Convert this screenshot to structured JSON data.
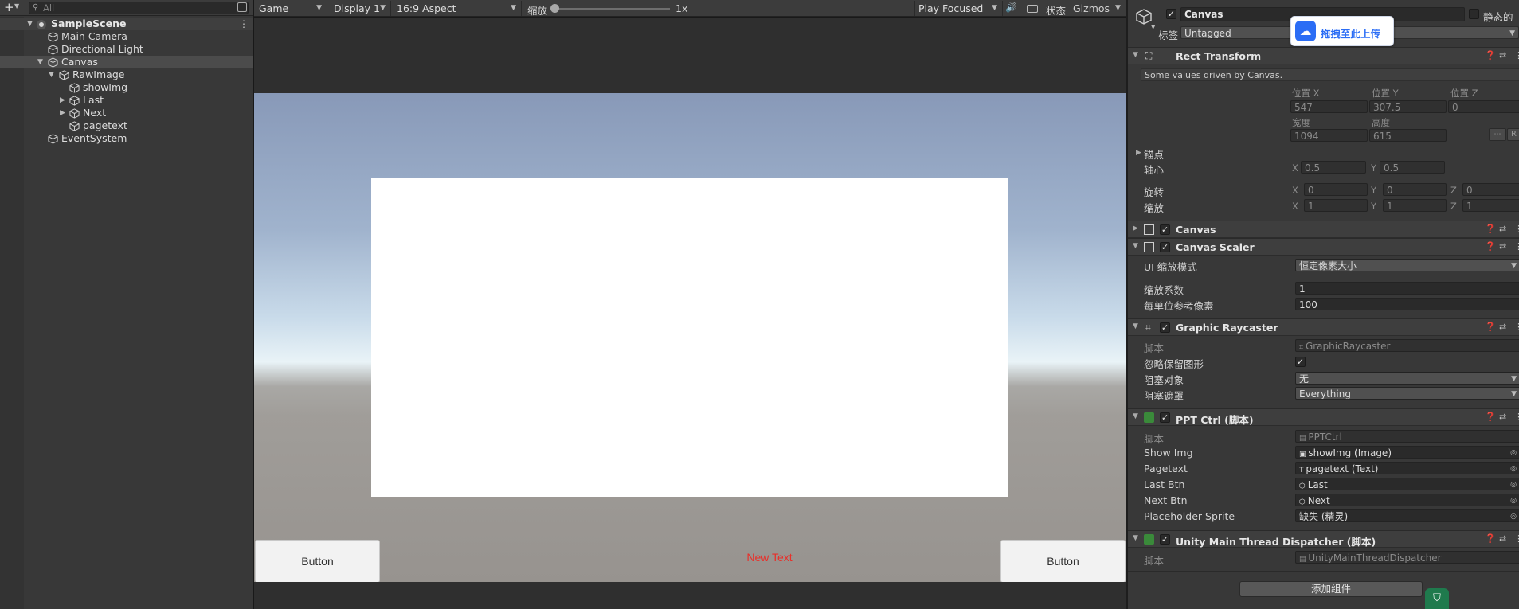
{
  "hierarchy": {
    "search_placeholder": "All",
    "scene": "SampleScene",
    "items": {
      "main_camera": "Main Camera",
      "directional_light": "Directional Light",
      "canvas": "Canvas",
      "rawimage": "RawImage",
      "showimg": "showImg",
      "last": "Last",
      "next": "Next",
      "pagetext": "pagetext",
      "eventsystem": "EventSystem"
    }
  },
  "gameview": {
    "view_select": "Game",
    "display_select": "Display 1",
    "aspect_select": "16:9 Aspect",
    "scale_label": "缩放",
    "scale_value": "1x",
    "play_mode": "Play Focused",
    "stats": "状态",
    "gizmos": "Gizmos",
    "button_left": "Button",
    "button_right": "Button",
    "center_text": "New Text"
  },
  "upload_badge": "拖拽至此上传",
  "inspector": {
    "object_name": "Canvas",
    "static_label": "静态的",
    "tag_label": "标签",
    "tag_value": "Untagged",
    "rect": {
      "title": "Rect Transform",
      "note": "Some values driven by Canvas.",
      "pos_x_label": "位置 X",
      "pos_y_label": "位置 Y",
      "pos_z_label": "位置 Z",
      "pos_x": "547",
      "pos_y": "307.5",
      "pos_z": "0",
      "width_label": "宽度",
      "height_label": "高度",
      "width": "1094",
      "height": "615",
      "r_btn": "R",
      "anchor_label": "锚点",
      "pivot_label": "轴心",
      "pivot_x": "0.5",
      "pivot_y": "0.5",
      "rotation_label": "旋转",
      "rot_x": "0",
      "rot_y": "0",
      "rot_z": "0",
      "scale_label": "缩放",
      "scale_x": "1",
      "scale_y": "1",
      "scale_z": "1",
      "x": "X",
      "y": "Y",
      "z": "Z"
    },
    "canvas_comp": {
      "title": "Canvas"
    },
    "scaler": {
      "title": "Canvas Scaler",
      "mode_label": "UI 缩放模式",
      "mode_value": "恒定像素大小",
      "factor_label": "缩放系数",
      "factor_value": "1",
      "ppu_label": "每单位参考像素",
      "ppu_value": "100"
    },
    "raycaster": {
      "title": "Graphic Raycaster",
      "script_label": "脚本",
      "script_value": "GraphicRaycaster",
      "ignore_label": "忽略保留图形",
      "block_obj_label": "阻塞对象",
      "block_obj_value": "无",
      "block_mask_label": "阻塞遮罩",
      "block_mask_value": "Everything"
    },
    "ppt": {
      "title": "PPT Ctrl  (脚本)",
      "script_label": "脚本",
      "script_value": "PPTCtrl",
      "show_img_label": "Show Img",
      "show_img_value": "showImg (Image)",
      "pagetext_label": "Pagetext",
      "pagetext_value": "pagetext (Text)",
      "last_label": "Last Btn",
      "last_value": "Last",
      "next_label": "Next Btn",
      "next_value": "Next",
      "placeholder_label": "Placeholder Sprite",
      "placeholder_value": "缺失 (精灵)"
    },
    "dispatcher": {
      "title": "Unity Main Thread Dispatcher  (脚本)",
      "script_label": "脚本",
      "script_value": "UnityMainThreadDispatcher"
    },
    "add_component": "添加组件"
  }
}
